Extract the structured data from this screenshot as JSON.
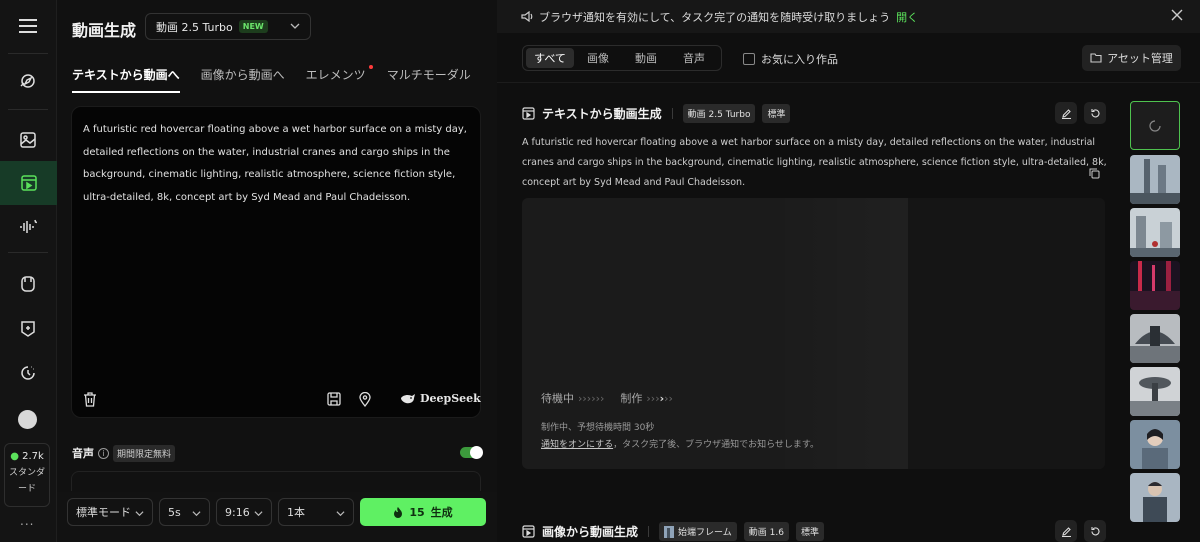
{
  "rail": {
    "credits_value": "2.7k",
    "plan_line1": "スタンダ",
    "plan_line2": "ード",
    "more": "..."
  },
  "panel": {
    "title": "動画生成",
    "model": {
      "name": "動画 2.5 Turbo",
      "badge": "NEW"
    },
    "tabs": [
      {
        "label": "テキストから動画へ",
        "active": true
      },
      {
        "label": "画像から動画へ"
      },
      {
        "label": "エレメンツ",
        "has_dot": true
      },
      {
        "label": "マルチモーダル"
      }
    ],
    "prompt": "A futuristic red hovercar floating above a wet harbor surface on a misty day, detailed reflections on the water, industrial cranes and cargo ships in the background, cinematic lighting, realistic atmosphere, science fiction style, ultra-detailed, 8k, concept art by Syd Mead and Paul Chadeisson.",
    "deepseek": "DeepSeek",
    "audio": {
      "label": "音声",
      "info": "i",
      "badge": "期間限定無料",
      "enabled": true
    },
    "controls": {
      "mode": "標準モード",
      "duration": "5s",
      "ratio": "9:16",
      "count": "1本",
      "generate_cost": "15",
      "generate_label": "生成"
    }
  },
  "right": {
    "notification": {
      "text": "ブラウザ通知を有効にして、タスク完了の通知を随時受け取りましょう",
      "link": "開く"
    },
    "filters": [
      {
        "label": "すべて",
        "active": true
      },
      {
        "label": "画像"
      },
      {
        "label": "動画"
      },
      {
        "label": "音声"
      }
    ],
    "favorites_label": "お気に入り作品",
    "asset_button": "アセット管理",
    "card1": {
      "title": "テキストから動画生成",
      "chips": [
        "動画 2.5 Turbo",
        "標準"
      ],
      "prompt": "A futuristic red hovercar floating above a wet harbor surface on a misty day, detailed reflections on the water, industrial cranes and cargo ships in the background, cinematic lighting, realistic atmosphere, science fiction style, ultra-detailed, 8k, concept art by Syd Mead and Paul Chadeisson.",
      "status_waiting": "待機中",
      "status_producing": "制作",
      "wait_info": "制作中、予想待機時間 30秒",
      "notify_link": "通知をオンにする",
      "notify_rest": "，タスク完了後、ブラウザ通知でお知らせします。"
    },
    "card2": {
      "title": "画像から動画生成",
      "chips": [
        "始端フレーム",
        "動画 1.6",
        "標準"
      ]
    }
  },
  "colors": {
    "accent": "#5ff063",
    "link_green": "#5be15b",
    "background": "#0f0f0f"
  }
}
